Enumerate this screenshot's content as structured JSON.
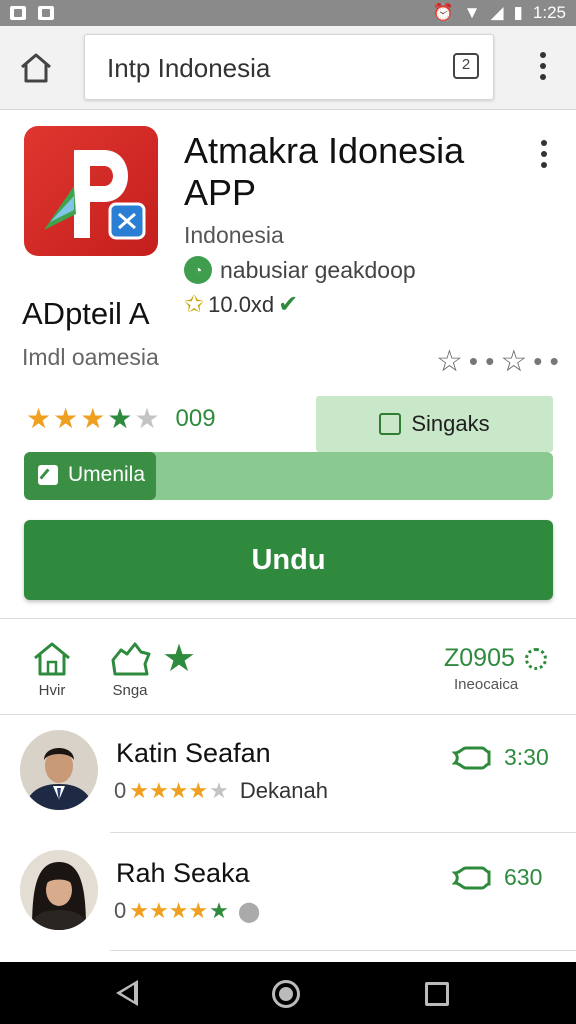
{
  "status_bar": {
    "time": "1:25"
  },
  "browser": {
    "url_text": "Intp Indonesia",
    "tab_count": "2"
  },
  "app": {
    "title": "Atmakra Idonesia APP",
    "subtitle": "Indonesia",
    "developer": "nabusiar geakdoop",
    "rating_value": "10.0xd",
    "label_a": "ADpteil A",
    "label_b": "Imdl oamesia",
    "fav_sep_1": "• •",
    "fav_sep_2": "• •"
  },
  "rating": {
    "stars_gold": 3,
    "stars_green": 1,
    "stars_grey": 1,
    "count": "009"
  },
  "buttons": {
    "secondary_label": "Singaks",
    "progress_label": "Umenila",
    "install_label": "Undu"
  },
  "progress": {
    "fill_fraction": 0.25
  },
  "stats": {
    "item1_label": "Hvir",
    "item2_label": "Snga",
    "value": "Z0905",
    "value_caption": "Ineocaica"
  },
  "reviews": [
    {
      "name": "Katin Seafan",
      "lead": "0",
      "stars": "★★★★",
      "extra": "★",
      "tag": "Dekanah",
      "value": "3:30"
    },
    {
      "name": "Rah Seaka",
      "lead": "0",
      "stars": "★★★★",
      "extra": "★",
      "tag": "",
      "value": "630"
    }
  ],
  "colors": {
    "accent_green": "#2f8a3d",
    "light_green": "#c9e7c9",
    "icon_red": "#e0362f",
    "star_gold": "#f0a020"
  }
}
